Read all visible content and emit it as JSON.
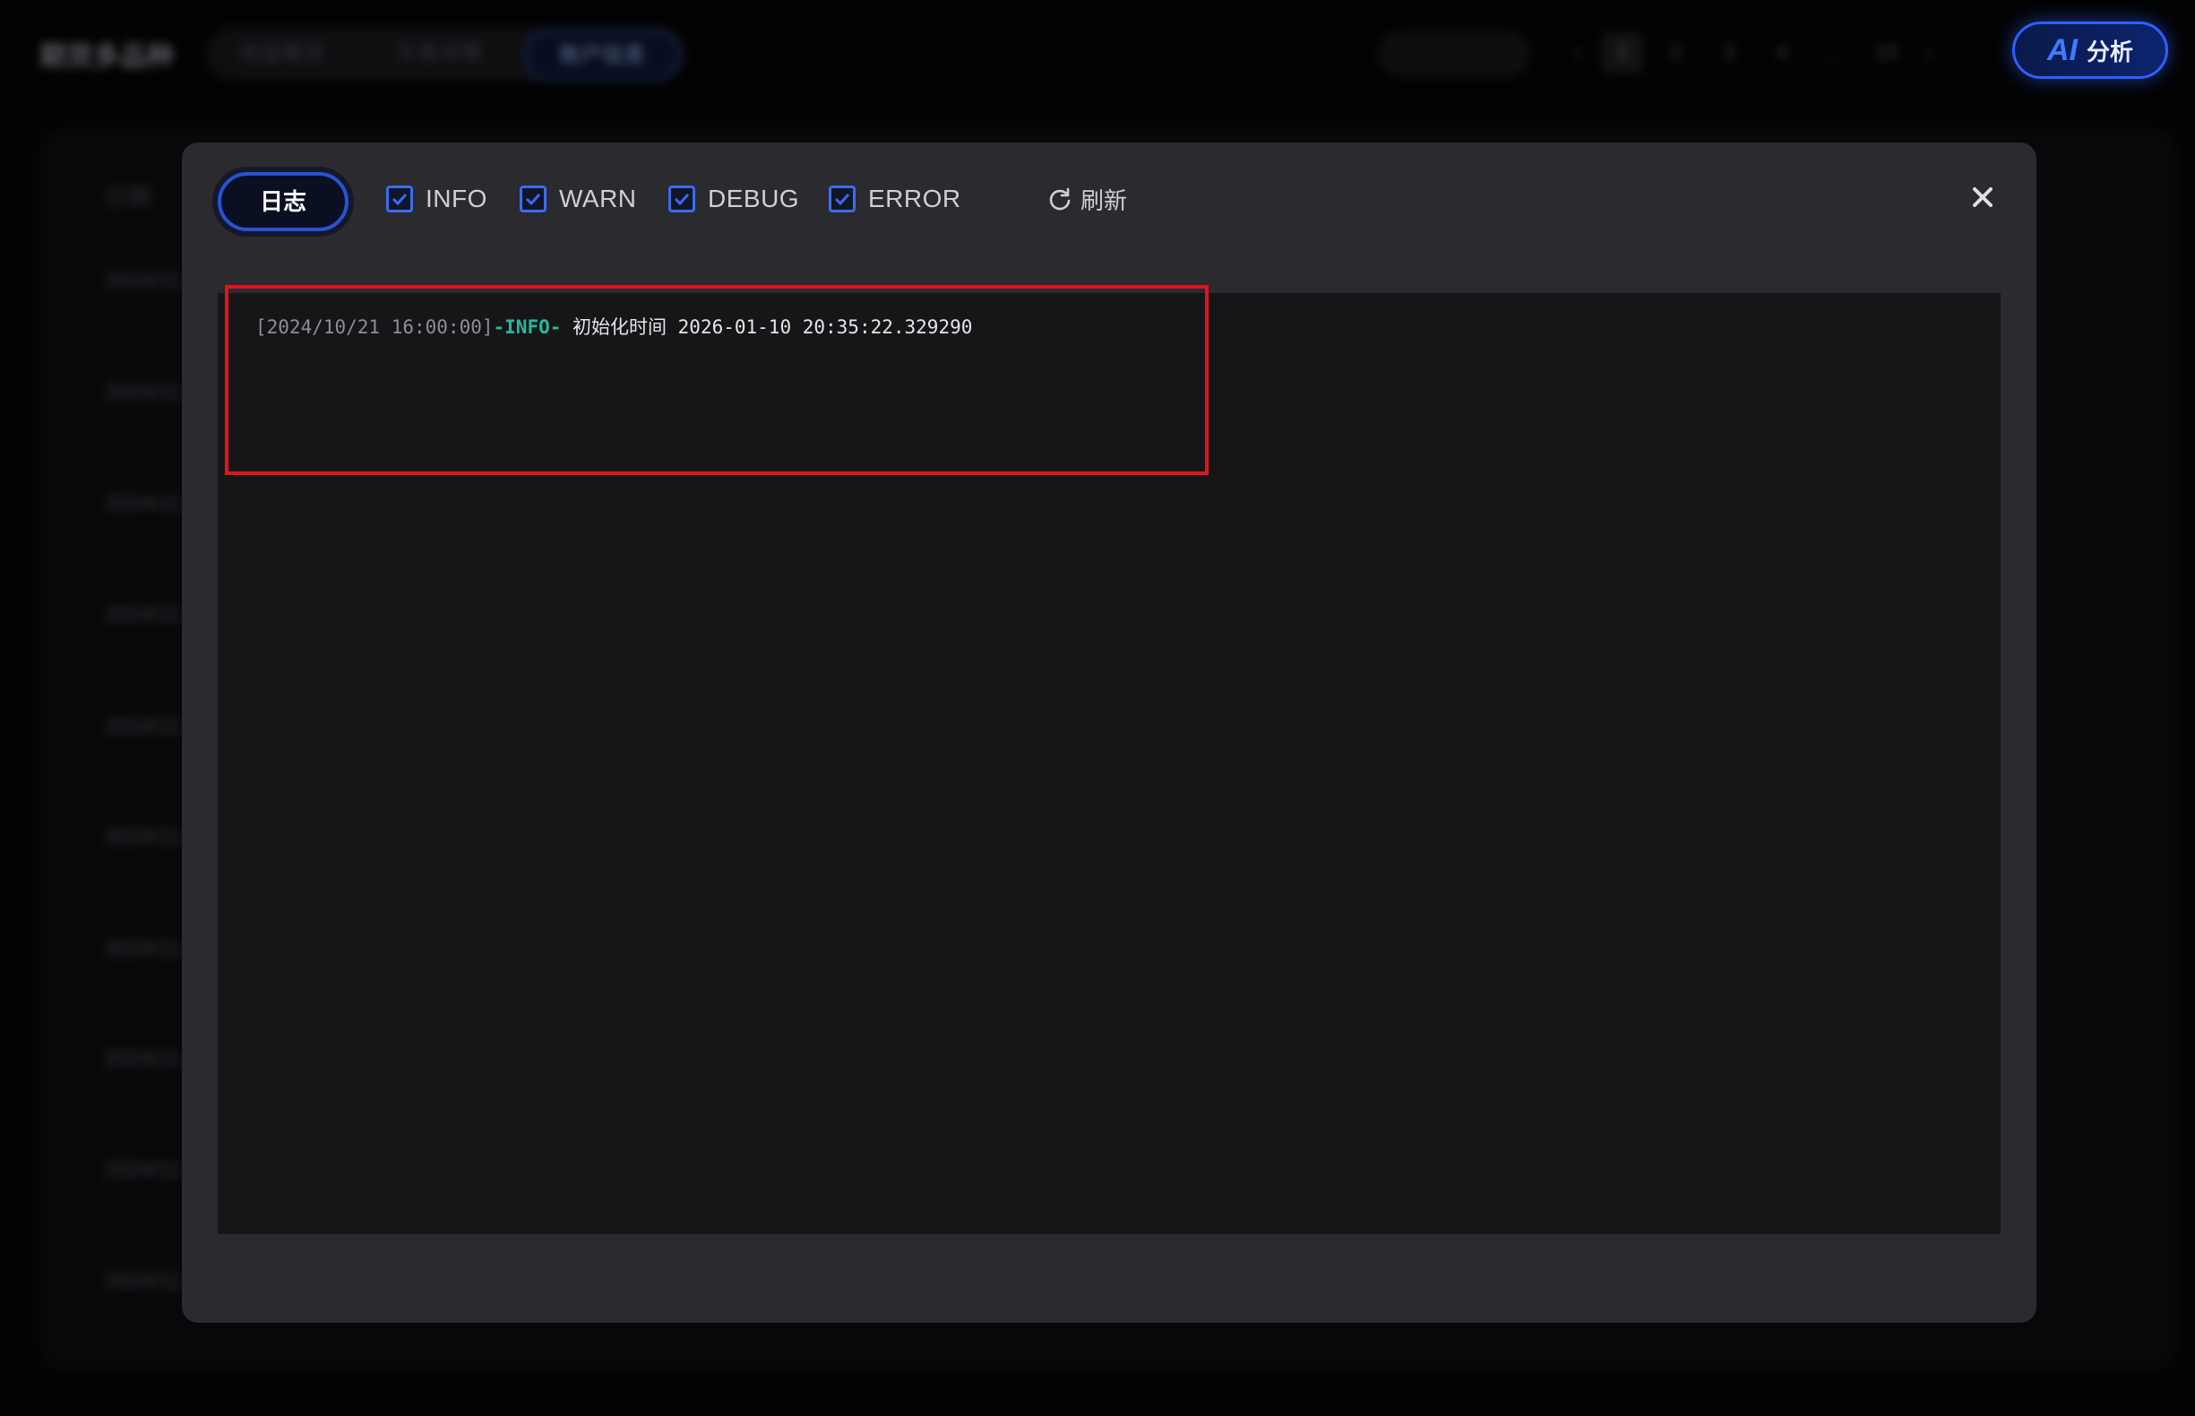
{
  "app": {
    "title": "期货多品种",
    "tabs": [
      {
        "label": "收益概览"
      },
      {
        "label": "交易详情"
      },
      {
        "label": "账户信息"
      }
    ],
    "action_pill": "查看日志",
    "pagination": {
      "prev": "‹",
      "pages": [
        "1",
        "2",
        "3",
        "4",
        "...",
        "15"
      ],
      "next": "›"
    },
    "ai_button": {
      "mark": "AI",
      "label": "分析"
    },
    "table": {
      "header": "日期",
      "rows": [
        "2024/11",
        "2024/11",
        "2024/11",
        "2024/11",
        "2024/11",
        "2024/11",
        "2024/11",
        "2024/11",
        "2024/11",
        "2024/11"
      ]
    }
  },
  "modal": {
    "tab_label": "日志",
    "filters": [
      {
        "label": "INFO",
        "checked": true
      },
      {
        "label": "WARN",
        "checked": true
      },
      {
        "label": "DEBUG",
        "checked": true
      },
      {
        "label": "ERROR",
        "checked": true
      }
    ],
    "refresh_label": "刷新",
    "close_icon": "close-icon",
    "log_lines": [
      {
        "timestamp": "[2024/10/21 16:00:00]",
        "level": "-INFO-",
        "message": " 初始化时间 2026-01-10 20:35:22.329290"
      }
    ]
  },
  "colors": {
    "accent": "#2f5fff",
    "info_level": "#27b89a",
    "highlight": "#e1141c",
    "modal_bg": "#2a2a2f",
    "log_bg": "#161618"
  }
}
